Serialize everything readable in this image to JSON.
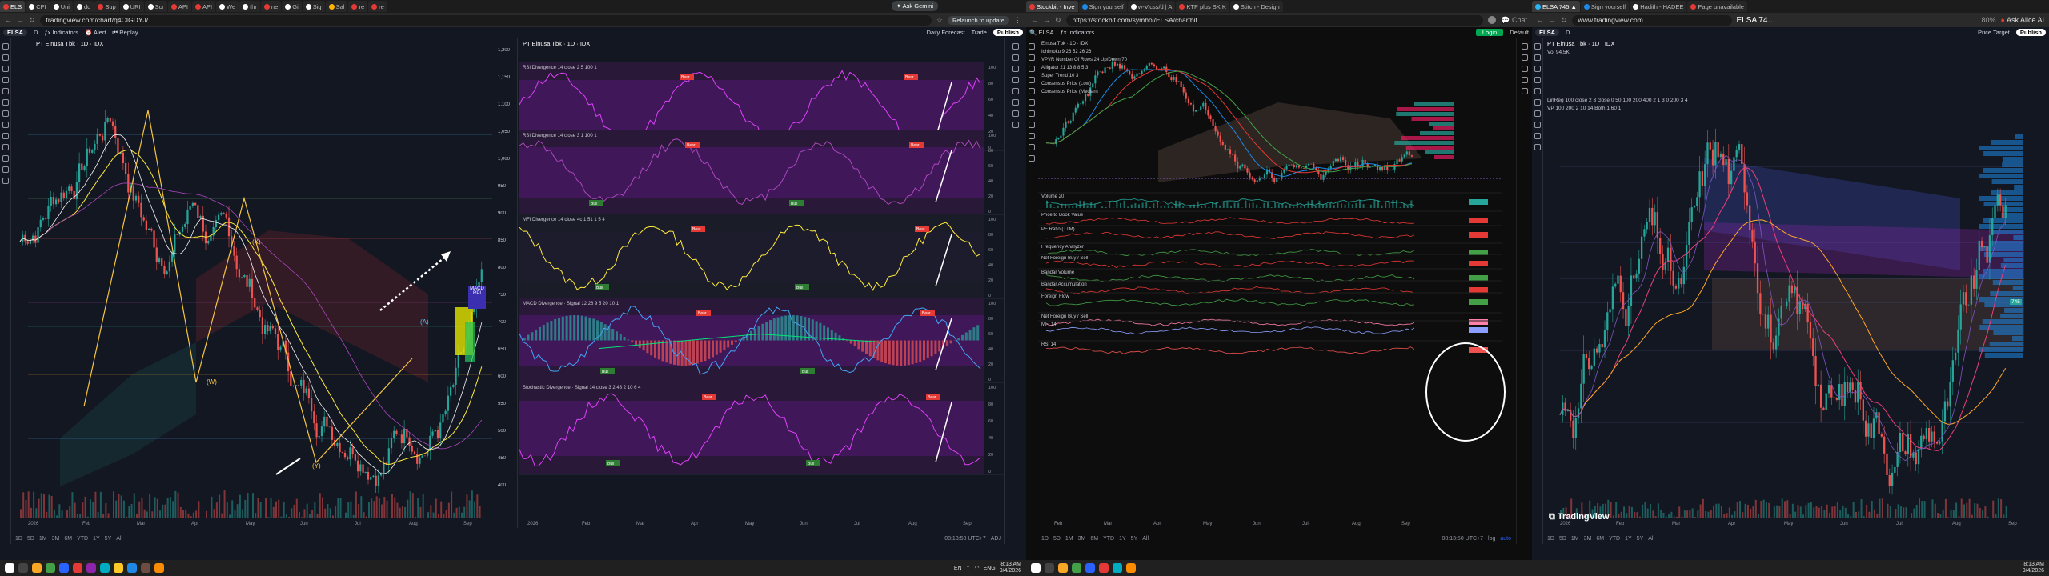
{
  "monitor1": {
    "tabs": [
      {
        "label": "ELS",
        "color": "#e53935",
        "active": true
      },
      {
        "label": "CPI",
        "color": "#fff"
      },
      {
        "label": "Uni",
        "color": "#fff"
      },
      {
        "label": "do",
        "color": "#fff"
      },
      {
        "label": "Sup",
        "color": "#e53935"
      },
      {
        "label": "URI",
        "color": "#fff"
      },
      {
        "label": "Scr",
        "color": "#fff"
      },
      {
        "label": "API",
        "color": "#e53935"
      },
      {
        "label": "API",
        "color": "#e53935"
      },
      {
        "label": "We",
        "color": "#fff"
      },
      {
        "label": "thr",
        "color": "#fff"
      },
      {
        "label": "ne",
        "color": "#e53935"
      },
      {
        "label": "Gi",
        "color": "#fff"
      },
      {
        "label": "Sig",
        "color": "#fff"
      },
      {
        "label": "Sal",
        "color": "#ffb300"
      },
      {
        "label": "re",
        "color": "#e53935"
      },
      {
        "label": "re",
        "color": "#e53935"
      }
    ],
    "ask_gemini": "Ask Gemini",
    "url": "tradingview.com/chart/q4CIGDYJ/",
    "relaunch": "Relaunch to update",
    "symbol": "ELSA",
    "interval": "D",
    "indicators": "Indicators",
    "alert": "Alert",
    "replay": "Replay",
    "layout_name": "Daily Forecast",
    "trade": "Trade",
    "publish": "Publish",
    "chart1_title": "PT Elnusa Tbk · 1D · IDX",
    "chart1_prices": [
      "1,200",
      "1,150",
      "1,100",
      "1,050",
      "1,000",
      "950",
      "900",
      "850",
      "800",
      "750",
      "700",
      "650",
      "600",
      "550",
      "500",
      "450",
      "400"
    ],
    "chart1_months": [
      "2026",
      "Feb",
      "Mar",
      "Apr",
      "May",
      "Jun",
      "Jul",
      "Aug",
      "Sep"
    ],
    "wave_labels": {
      "x": "(X)",
      "w": "(W)",
      "y": "(Y)",
      "a": "(A)"
    },
    "panel_macd_label": "MACD RPI",
    "chart2_title": "PT Elnusa Tbk · 1D · IDX",
    "indicator_titles": [
      "RSI Divergence 14 close 2 5 100 1",
      "RSI Divergence 14 close 3 1 100 1",
      "MFI Divergence 14 close 4c 1 51 1 5 4",
      "MACD Divergence · Signal 12 26 9 5 20 10 1",
      "Stochastic Divergence · Signal 14 close 3 2 48 2 10 6 4"
    ],
    "bull": "Bull",
    "bear": "Bear",
    "tf_buttons": [
      "1D",
      "5D",
      "1M",
      "3M",
      "6M",
      "YTD",
      "1Y",
      "5Y",
      "All"
    ],
    "chart2_months": [
      "2026",
      "Feb",
      "Mar",
      "Apr",
      "May",
      "Jun",
      "Jul",
      "Aug",
      "Sep"
    ],
    "osc_scale": [
      "100",
      "80",
      "60",
      "40",
      "20",
      "0"
    ],
    "time_readout": "08:13:50 UTC+7",
    "adj": "ADJ",
    "taskbar_lang": "EN",
    "taskbar_eng": "ENG",
    "clock_time": "8:13 AM",
    "clock_date": "9/4/2026"
  },
  "monitor2": {
    "tabs": [
      {
        "label": "Stockbit - Inve",
        "color": "#e53935",
        "active": true
      },
      {
        "label": "Sign yourself",
        "color": "#1e88e5"
      },
      {
        "label": "w-V.css/d | A",
        "color": "#fff"
      },
      {
        "label": "KTP plus SK K",
        "color": "#e53935"
      },
      {
        "label": "Stitch - Design",
        "color": "#fff"
      }
    ],
    "url": "https://stockbit.com/symbol/ELSA/chartbit",
    "chat": "Chat",
    "symbol": "ELSA",
    "indicators": "Indicators",
    "login": "Login",
    "default": "Default",
    "legend": [
      "Elnusa Tbk · 1D · IDX",
      "Ichimoku 9 26 52 26 26",
      "VPVR Number Of Rows 24 Up/Down 70",
      "Alligator 21 13 8 8 5 3",
      "Super Trend 10 3",
      "Consensus Price (Low)",
      "Consensus Price (Median)"
    ],
    "panels": [
      "Volume 20",
      "Price to Book Value",
      "PE Ratio (TTM)",
      "Frequency Analyzer",
      "Net Foreign Buy / Sell",
      "Bandar Volume",
      "Bandar Accumulation",
      "Foreign Flow",
      "Net Foreign Buy / Sell",
      "MFI 14",
      "RSI 14"
    ],
    "months": [
      "Feb",
      "Mar",
      "Apr",
      "May",
      "Jun",
      "Jul",
      "Aug",
      "Sep"
    ],
    "tf_buttons": [
      "1D",
      "5D",
      "1M",
      "3M",
      "6M",
      "YTD",
      "1Y",
      "5Y",
      "All"
    ],
    "time_readout": "08:13:50 UTC+7",
    "log": "log",
    "auto": "auto"
  },
  "monitor3": {
    "tabs": [
      {
        "label": "ELSA 745 ▲",
        "color": "#29b6f6",
        "active": true
      },
      {
        "label": "Sign yourself",
        "color": "#1e88e5"
      },
      {
        "label": "Hadith - HADEE",
        "color": "#fff"
      },
      {
        "label": "Page unavailable",
        "color": "#e53935"
      }
    ],
    "url": "www.tradingview.com",
    "page_title": "ELSA 74…",
    "zoom": "80%",
    "ask": "Ask Alice AI",
    "symbol": "ELSA",
    "interval": "D",
    "price_target": "Price Target",
    "publish": "Publish",
    "chart_title": "PT Elnusa Tbk · 1D · IDX",
    "legend2": "LinReg 100 close 2 3 close 0 50 100 200 400 2 1 3 0 200 3 4",
    "legend3": "VP 100 200 2 10 14 Both 1 60 1",
    "vol_label": "Vol 94.5K",
    "months": [
      "2026",
      "Feb",
      "Mar",
      "Apr",
      "May",
      "Jun",
      "Jul",
      "Aug",
      "Sep"
    ],
    "tf_buttons": [
      "1D",
      "5D",
      "1M",
      "3M",
      "6M",
      "YTD",
      "1Y",
      "5Y",
      "All"
    ],
    "brand": "TradingView",
    "price_current": "745",
    "clock_time": "8:13 AM",
    "clock_date": "9/4/2026"
  }
}
